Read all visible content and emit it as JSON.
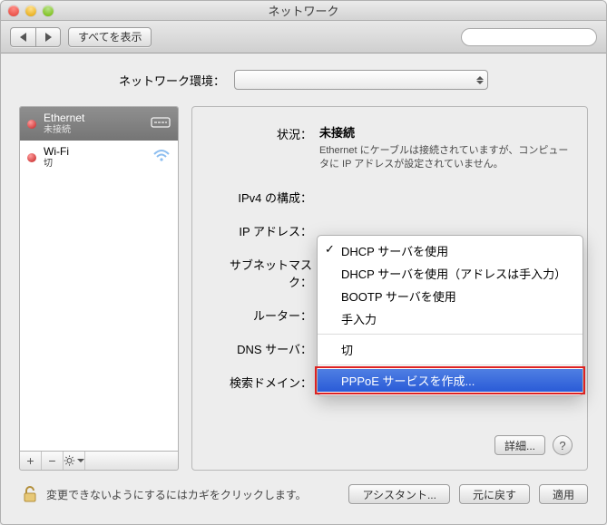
{
  "window": {
    "title": "ネットワーク"
  },
  "toolbar": {
    "show_all": "すべてを表示",
    "search_placeholder": ""
  },
  "env": {
    "label": "ネットワーク環境：",
    "value": ""
  },
  "sidebar": {
    "items": [
      {
        "name": "Ethernet",
        "status": "未接続"
      },
      {
        "name": "Wi-Fi",
        "status": "切"
      }
    ],
    "buttons": {
      "add": "+",
      "remove": "−",
      "gear": "✻"
    }
  },
  "detail": {
    "labels": {
      "status": "状況：",
      "ipv4": "IPv4 の構成：",
      "ip": "IP アドレス：",
      "subnet": "サブネットマスク：",
      "router": "ルーター：",
      "dns": "DNS サーバ：",
      "search": "検索ドメイン："
    },
    "status_value": "未接続",
    "status_desc": "Ethernet にケーブルは接続されていますが、コンピュータに IP アドレスが設定されていません。",
    "advanced": "詳細...",
    "help": "?"
  },
  "ipv4_menu": {
    "items": [
      {
        "label": "DHCP サーバを使用",
        "checked": true
      },
      {
        "label": "DHCP サーバを使用（アドレスは手入力）"
      },
      {
        "label": "BOOTP サーバを使用"
      },
      {
        "label": "手入力"
      }
    ],
    "off": "切",
    "create_pppoe": "PPPoE サービスを作成..."
  },
  "footer": {
    "lock_text": "変更できないようにするにはカギをクリックします。",
    "assistant": "アシスタント...",
    "revert": "元に戻す",
    "apply": "適用"
  }
}
